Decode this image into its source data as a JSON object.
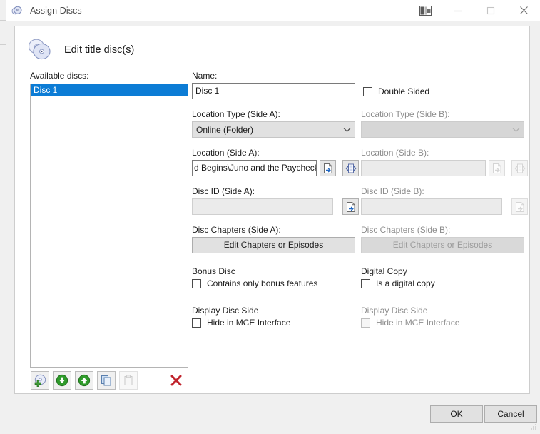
{
  "window": {
    "title": "Assign Discs",
    "icon": "disc-icon",
    "controls": {
      "extra_icon": "panel-layout-icon",
      "minimize": "minimize-icon",
      "maximize": "maximize-icon",
      "close": "close-icon"
    }
  },
  "heading": {
    "icon": "two-discs-icon",
    "text": "Edit title disc(s)"
  },
  "discs_panel": {
    "label": "Available discs:",
    "items": [
      {
        "label": "Disc 1",
        "selected": true
      }
    ],
    "toolbar": [
      {
        "name": "add-disc-button",
        "icon": "disc-add-icon",
        "enabled": true
      },
      {
        "name": "move-down-button",
        "icon": "arrow-down-circle-icon",
        "enabled": true
      },
      {
        "name": "move-up-button",
        "icon": "arrow-up-circle-icon",
        "enabled": true
      },
      {
        "name": "copy-button",
        "icon": "copy-icon",
        "enabled": true
      },
      {
        "name": "paste-button",
        "icon": "paste-icon",
        "enabled": false
      },
      {
        "name": "delete-button",
        "icon": "red-x-icon",
        "enabled": true
      }
    ]
  },
  "form": {
    "name": {
      "label": "Name:",
      "value": "Disc 1",
      "placeholder": ""
    },
    "double_sided": {
      "label": "Double Sided",
      "checked": false
    },
    "location_type_a": {
      "label": "Location Type (Side A):",
      "value": "Online (Folder)",
      "enabled": true,
      "options": [
        "Online (Folder)"
      ]
    },
    "location_type_b": {
      "label": "Location Type (Side B):",
      "value": "",
      "enabled": false,
      "options": []
    },
    "location_a": {
      "label": "Location (Side A):",
      "value": "d Begins\\Juno and the Paycheck",
      "enabled": true,
      "browse_icon": "browse-folder-icon",
      "media_icon": "media-scan-icon"
    },
    "location_b": {
      "label": "Location (Side B):",
      "value": "",
      "enabled": false,
      "browse_icon": "browse-folder-icon",
      "media_icon": "media-scan-icon"
    },
    "disc_id_a": {
      "label": "Disc ID (Side A):",
      "value": "",
      "enabled": false,
      "browse_icon": "browse-folder-icon",
      "browse_enabled": true
    },
    "disc_id_b": {
      "label": "Disc ID (Side B):",
      "value": "",
      "enabled": false,
      "browse_icon": "browse-folder-icon",
      "browse_enabled": false
    },
    "chapters_a": {
      "label": "Disc Chapters (Side A):",
      "button_label": "Edit Chapters or Episodes",
      "enabled": true
    },
    "chapters_b": {
      "label": "Disc Chapters (Side B):",
      "button_label": "Edit Chapters or Episodes",
      "enabled": false
    },
    "bonus_disc": {
      "group_label": "Bonus Disc",
      "checkbox_label": "Contains only bonus features",
      "checked": false,
      "enabled": true
    },
    "digital_copy": {
      "group_label": "Digital Copy",
      "checkbox_label": "Is a digital copy",
      "checked": false,
      "enabled": true
    },
    "display_side_a": {
      "group_label": "Display Disc Side",
      "checkbox_label": "Hide in MCE Interface",
      "checked": false,
      "enabled": true
    },
    "display_side_b": {
      "group_label": "Display Disc Side",
      "checkbox_label": "Hide in MCE Interface",
      "checked": false,
      "enabled": false
    }
  },
  "footer": {
    "ok_label": "OK",
    "cancel_label": "Cancel"
  },
  "colors": {
    "selection_blue": "#0c7cd5",
    "delete_red": "#c0232c",
    "arrow_green": "#2b9a28",
    "window_bg": "#f0f0f0",
    "client_bg": "#ffffff"
  }
}
